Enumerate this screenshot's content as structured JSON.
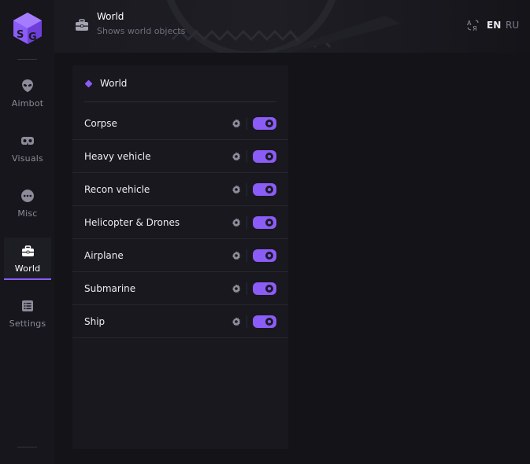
{
  "colors": {
    "accent": "#8b5cf6",
    "background": "#121218",
    "sidebar": "#16161c",
    "panel": "#18181e"
  },
  "brand": {
    "logo_icon": "sg-cube-logo"
  },
  "sidebar": {
    "items": [
      {
        "label": "Aimbot",
        "icon": "alien-icon",
        "active": false
      },
      {
        "label": "Visuals",
        "icon": "vr-goggles-icon",
        "active": false
      },
      {
        "label": "Misc",
        "icon": "dots-circle-icon",
        "active": false
      },
      {
        "label": "World",
        "icon": "briefcase-icon",
        "active": true
      },
      {
        "label": "Settings",
        "icon": "list-icon",
        "active": false
      }
    ]
  },
  "header": {
    "icon": "briefcase-icon",
    "title": "World",
    "subtitle": "Shows world objects"
  },
  "language": {
    "icon": "translate-icon",
    "options": [
      "EN",
      "RU"
    ],
    "selected": "EN"
  },
  "panel": {
    "title": "World",
    "rows": [
      {
        "label": "Corpse",
        "enabled": true
      },
      {
        "label": "Heavy vehicle",
        "enabled": true
      },
      {
        "label": "Recon vehicle",
        "enabled": true
      },
      {
        "label": "Helicopter & Drones",
        "enabled": true
      },
      {
        "label": "Airplane",
        "enabled": true
      },
      {
        "label": "Submarine",
        "enabled": true
      },
      {
        "label": "Ship",
        "enabled": true
      }
    ]
  }
}
